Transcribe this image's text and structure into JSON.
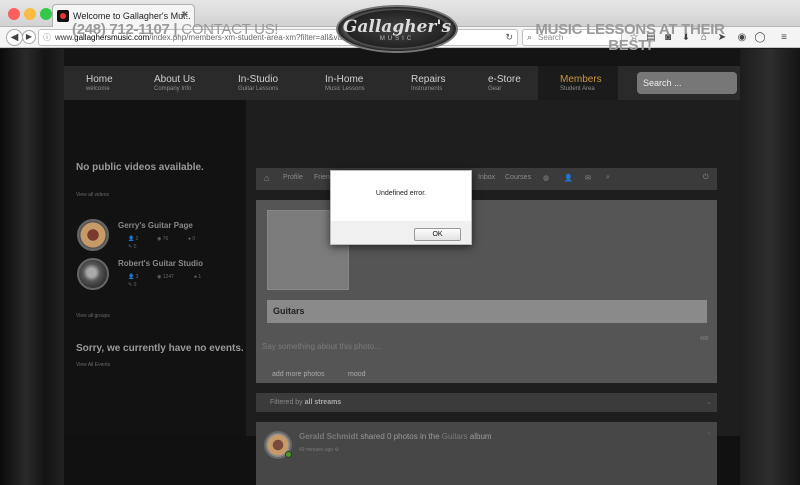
{
  "browser": {
    "tab_title": "Welcome to Gallagher's Mu...",
    "new_tab": "+",
    "url_prefix": "www.",
    "url_domain": "gallaghersmusic.com",
    "url_path": "/index.php/members-xm-student-area-xm?filter=all&value=",
    "search_placeholder": "Search",
    "icons": [
      "star-icon",
      "reading-list-icon",
      "pocket-icon",
      "download-icon",
      "home-icon",
      "send-icon",
      "sync-icon",
      "chat-icon",
      "menu-icon"
    ]
  },
  "header": {
    "phone": "(248) 712-1107 | ",
    "contact": "CONTACT US!",
    "logo": "Gallagher's",
    "logo_sub": "MUSIC",
    "tagline": "MUSIC LESSONS AT THEIR BEST!"
  },
  "menu": {
    "items": [
      {
        "title": "Home",
        "sub": "welcome"
      },
      {
        "title": "About Us",
        "sub": "Company Info"
      },
      {
        "title": "In-Studio",
        "sub": "Guitar Lessons"
      },
      {
        "title": "In-Home",
        "sub": "Music Lessons"
      },
      {
        "title": "Repairs",
        "sub": "Instruments"
      },
      {
        "title": "e-Store",
        "sub": "Gear"
      },
      {
        "title": "Members",
        "sub": "Student Area"
      }
    ],
    "search_placeholder": "Search ...",
    "accent": "#c8963e"
  },
  "left": {
    "videos_heading": "No public videos available.",
    "view_all_videos": "View all videos",
    "groups": [
      {
        "name": "Gerry's Guitar Page",
        "members": "2",
        "views": "76",
        "comments": "0",
        "edits": "0"
      },
      {
        "name": "Robert's Guitar Studio",
        "members": "3",
        "views": "1247",
        "comments": "1",
        "edits": "0"
      }
    ],
    "view_all_groups": "View all groups",
    "events_heading": "Sorry, we currently have no events.",
    "view_all_events": "View All Events"
  },
  "social": {
    "nav": [
      "Profile",
      "Frien",
      "Inbox",
      "Courses"
    ],
    "album_title": "Guitars",
    "say_placeholder": "Say something about this photo...",
    "char_count": "400",
    "actions": [
      "add more photos",
      "mood"
    ],
    "filter_label": "Filtered by ",
    "filter_value": "all streams",
    "feed": {
      "user": "Gerald Schmidt",
      "action": " shared 0 photos in the ",
      "album": "Guitars",
      "suffix": " album",
      "time": "49 minutes ago"
    }
  },
  "dialog": {
    "message": "Undefined error.",
    "ok_label": "OK"
  }
}
